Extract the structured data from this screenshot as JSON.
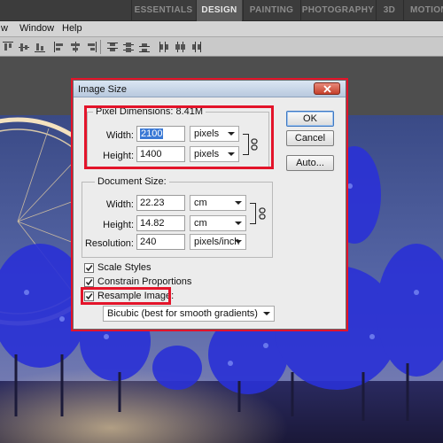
{
  "workspace_bar": {
    "items": [
      {
        "label": "ESSENTIALS",
        "active": false
      },
      {
        "label": "DESIGN",
        "active": true
      },
      {
        "label": "PAINTING",
        "active": false
      },
      {
        "label": "PHOTOGRAPHY",
        "active": false
      },
      {
        "label": "3D",
        "active": false
      },
      {
        "label": "MOTION",
        "active": false
      }
    ]
  },
  "menu_bar": {
    "items": [
      "w",
      "Window",
      "Help"
    ]
  },
  "dialog": {
    "title": "Image Size",
    "pixel_dimensions": {
      "label": "Pixel Dimensions:",
      "size": "8.41M",
      "width_label": "Width:",
      "width_value": "2100",
      "width_unit": "pixels",
      "height_label": "Height:",
      "height_value": "1400",
      "height_unit": "pixels"
    },
    "document_size": {
      "label": "Document Size:",
      "width_label": "Width:",
      "width_value": "22.23",
      "width_unit": "cm",
      "height_label": "Height:",
      "height_value": "14.82",
      "height_unit": "cm",
      "resolution_label": "Resolution:",
      "resolution_value": "240",
      "resolution_unit": "pixels/inch"
    },
    "buttons": {
      "ok": "OK",
      "cancel": "Cancel",
      "auto": "Auto..."
    },
    "checkboxes": {
      "scale_styles": {
        "label": "Scale Styles",
        "checked": true
      },
      "constrain_proportions": {
        "label": "Constrain Proportions",
        "checked": true
      },
      "resample_image": {
        "label": "Resample Image:",
        "checked": true
      }
    },
    "resample_method": "Bicubic (best for smooth gradients)"
  },
  "colors": {
    "highlight": "#e3142a",
    "workspace_active": "#5c5c5c",
    "dialog_bg": "#ececec"
  }
}
